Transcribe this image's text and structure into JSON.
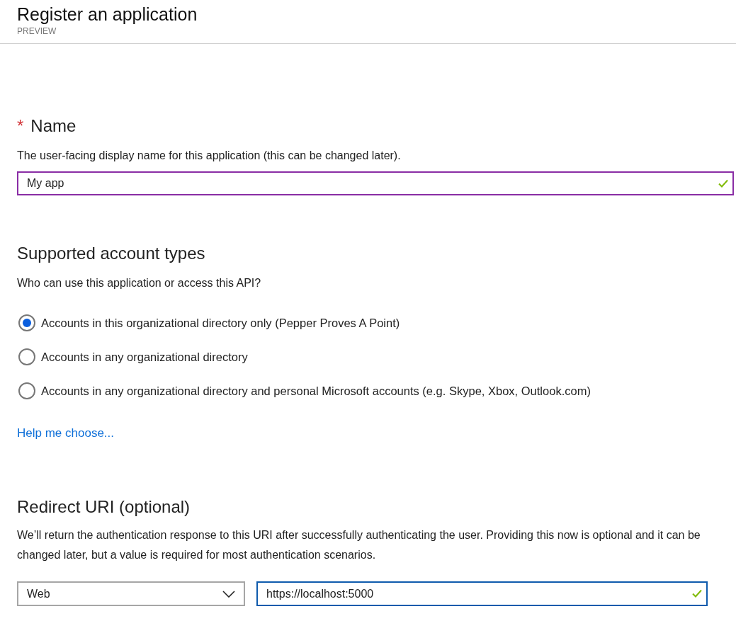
{
  "header": {
    "title": "Register an application",
    "subtitle": "PREVIEW"
  },
  "name_section": {
    "required_mark": "*",
    "heading": "Name",
    "description": "The user-facing display name for this application (this can be changed later).",
    "field": {
      "value": "My app",
      "valid": true,
      "hovered": true
    }
  },
  "accounts_section": {
    "heading": "Supported account types",
    "question": "Who can use this application or access this API?",
    "options": [
      {
        "label": "Accounts in this organizational directory only (Pepper Proves A Point)",
        "selected": true
      },
      {
        "label": "Accounts in any organizational directory",
        "selected": false
      },
      {
        "label": "Accounts in any organizational directory and personal Microsoft accounts (e.g. Skype, Xbox, Outlook.com)",
        "selected": false
      }
    ],
    "help_link": "Help me choose..."
  },
  "redirect_section": {
    "heading": "Redirect URI (optional)",
    "description": "We’ll return the authentication response to this URI after successfully authenticating the user. Providing this now is optional and it can be changed later, but a value is required for most authentication scenarios.",
    "platform": {
      "value": "Web"
    },
    "uri_field": {
      "value": "https://localhost:5000",
      "valid": true,
      "focused": true
    }
  }
}
